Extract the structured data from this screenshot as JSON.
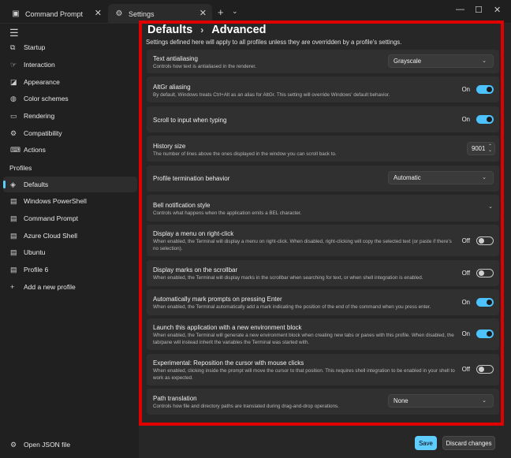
{
  "titlebar": {
    "tabs": [
      {
        "label": "Command Prompt",
        "icon": "terminal-icon"
      },
      {
        "label": "Settings",
        "icon": "gear-icon"
      }
    ],
    "new_tab": "+",
    "dropdown": "⌄",
    "minimize": "—",
    "maximize": "☐",
    "close": "✕"
  },
  "sidebar": {
    "menu_icon": "☰",
    "items": [
      {
        "label": "Startup",
        "icon": "startup-icon",
        "glyph": "⧉"
      },
      {
        "label": "Interaction",
        "icon": "interaction-icon",
        "glyph": "☞"
      },
      {
        "label": "Appearance",
        "icon": "appearance-icon",
        "glyph": "◪"
      },
      {
        "label": "Color schemes",
        "icon": "palette-icon",
        "glyph": "◍"
      },
      {
        "label": "Rendering",
        "icon": "rendering-icon",
        "glyph": "▭"
      },
      {
        "label": "Compatibility",
        "icon": "compatibility-icon",
        "glyph": "⚙"
      },
      {
        "label": "Actions",
        "icon": "keyboard-icon",
        "glyph": "⌨"
      }
    ],
    "profiles_header": "Profiles",
    "profiles": [
      {
        "label": "Defaults",
        "icon": "layers-icon",
        "glyph": "◈",
        "selected": true
      },
      {
        "label": "Windows PowerShell",
        "icon": "powershell-icon",
        "glyph": "▤"
      },
      {
        "label": "Command Prompt",
        "icon": "cmd-icon",
        "glyph": "▤"
      },
      {
        "label": "Azure Cloud Shell",
        "icon": "azure-icon",
        "glyph": "▤"
      },
      {
        "label": "Ubuntu",
        "icon": "ubuntu-icon",
        "glyph": "▤"
      },
      {
        "label": "Profile 6",
        "icon": "profile-icon",
        "glyph": "▤"
      },
      {
        "label": "Add a new profile",
        "icon": "plus-icon",
        "glyph": "+"
      }
    ],
    "open_json": "Open JSON file",
    "open_json_glyph": "⚙"
  },
  "main": {
    "breadcrumb_root": "Defaults",
    "breadcrumb_sep": "›",
    "breadcrumb_current": "Advanced",
    "subtitle": "Settings defined here will apply to all profiles unless they are overridden by a profile's settings.",
    "settings": [
      {
        "title": "Text antialiasing",
        "desc": "Controls how text is antialiased in the renderer.",
        "control": "dropdown",
        "value": "Grayscale"
      },
      {
        "title": "AltGr aliasing",
        "desc": "By default, Windows treats Ctrl+Alt as an alias for AltGr. This setting will override Windows' default behavior.",
        "control": "toggle",
        "value": "On"
      },
      {
        "title": "Scroll to input when typing",
        "desc": "",
        "control": "toggle",
        "value": "On"
      },
      {
        "title": "History size",
        "desc": "The number of lines above the ones displayed in the window you can scroll back to.",
        "control": "number",
        "value": "9001"
      },
      {
        "title": "Profile termination behavior",
        "desc": "",
        "control": "dropdown",
        "value": "Automatic"
      },
      {
        "title": "Bell notification style",
        "desc": "Controls what happens when the application emits a BEL character.",
        "control": "expander",
        "value": ""
      },
      {
        "title": "Display a menu on right-click",
        "desc": "When enabled, the Terminal will display a menu on right-click. When disabled, right-clicking will copy the selected text (or paste if there's no selection).",
        "control": "toggle",
        "value": "Off"
      },
      {
        "title": "Display marks on the scrollbar",
        "desc": "When enabled, the Terminal will display marks in the scrollbar when searching for text, or when shell integration is enabled.",
        "control": "toggle",
        "value": "Off"
      },
      {
        "title": "Automatically mark prompts on pressing Enter",
        "desc": "When enabled, the Terminal automatically add a mark indicating the position of the end of the command when you press enter.",
        "control": "toggle",
        "value": "On"
      },
      {
        "title": "Launch this application with a new environment block",
        "desc": "When enabled, the Terminal will generate a new environment block when creating new tabs or panes with this profile. When disabled, the tab/pane will instead inherit the variables the Terminal was started with.",
        "control": "toggle",
        "value": "On"
      },
      {
        "title": "Experimental: Reposition the cursor with mouse clicks",
        "desc": "When enabled, clicking inside the prompt will move the cursor to that position. This requires shell integration to be enabled in your shell to work as expected.",
        "control": "toggle",
        "value": "Off"
      },
      {
        "title": "Path translation",
        "desc": "Controls how file and directory paths are translated during drag-and-drop operations.",
        "control": "dropdown",
        "value": "None"
      }
    ]
  },
  "footer": {
    "save": "Save",
    "discard": "Discard changes"
  },
  "colors": {
    "accent": "#60cdff",
    "toggle_on": "#4cc2ff",
    "highlight_box": "#e00000"
  }
}
